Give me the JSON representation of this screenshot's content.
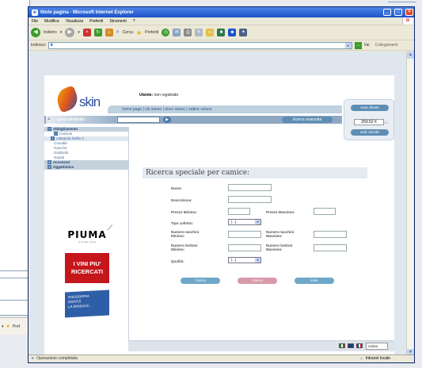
{
  "window": {
    "title": "titolo pagina - Microsoft Internet Explorer",
    "minimize": "_",
    "maximize": "□",
    "close": "×"
  },
  "menu": [
    "File",
    "Modifica",
    "Visualizza",
    "Preferiti",
    "Strumenti",
    "?"
  ],
  "toolbar": {
    "back_label": "Indietro",
    "search_label": "Cerca",
    "favorites_label": "Preferiti"
  },
  "address": {
    "label": "Indirizzo",
    "go_label": "Vai",
    "links_label": "Collegamenti"
  },
  "site": {
    "logo_text": "skin",
    "user_label": "Utente:",
    "user_status": "non registrato",
    "nav": "home page | chi siamo | dove siamo | ordine veloce",
    "search_label": "cerca prodotto",
    "advanced_search": "ricerca avanzata",
    "area_clienti": "Area cliente",
    "cart_total": "259.52 €",
    "view_cart": "vedi carrello"
  },
  "categories": [
    {
      "label": "Abbigliamento",
      "level": "h"
    },
    {
      "label": "Camicie",
      "level": "sub"
    },
    {
      "label": "categoria livello 3",
      "level": "l2"
    },
    {
      "label": "Cravatte",
      "level": "sub"
    },
    {
      "label": "Giacche",
      "level": "sub"
    },
    {
      "label": "Giubbotti",
      "level": "sub"
    },
    {
      "label": "Guanti",
      "level": "sub"
    },
    {
      "label": "Accessori",
      "level": "h"
    },
    {
      "label": "Oggettistica",
      "level": "h"
    }
  ],
  "ads": {
    "brand": "PIUMA",
    "brand_url": "p i u m a . c o m",
    "vini_line1": "I VINI PIU'",
    "vini_line2": "RICERCATI",
    "promo_line1": "RADDOPPIA",
    "promo_line2": "GRATIS",
    "promo_line3": "LA BANDA E..."
  },
  "form": {
    "title": "Ricerca speciale per camice:",
    "nome": "Nome:",
    "descrizione": "Descrizione:",
    "prezzo_minimo": "Prezzo Minimo:",
    "prezzo_massimo": "Prezzo Massimo:",
    "tipo_colletto": "Tipo colletto:",
    "tipo_colletto_value": "[...]",
    "taschini_min_1": "Numero taschini",
    "taschini_min_2": "Minimo:",
    "taschini_max_1": "Numero taschini",
    "taschini_max_2": "Massimo:",
    "bottoni_min_1": "Numero bottoni",
    "bottoni_min_2": "Minimo:",
    "bottoni_max_1": "Numero bottoni",
    "bottoni_max_2": "Massimo:",
    "qualita": "Qualità:",
    "qualita_value": "[...]",
    "btn_1": "ricerca",
    "btn_2": "ricerca",
    "btn_3": "invia"
  },
  "footer": {
    "valuta": "valuta"
  },
  "status": {
    "left": "Operazione completata",
    "zone": "Intranet locale"
  },
  "bg": {
    "fav_label": "Pref"
  }
}
